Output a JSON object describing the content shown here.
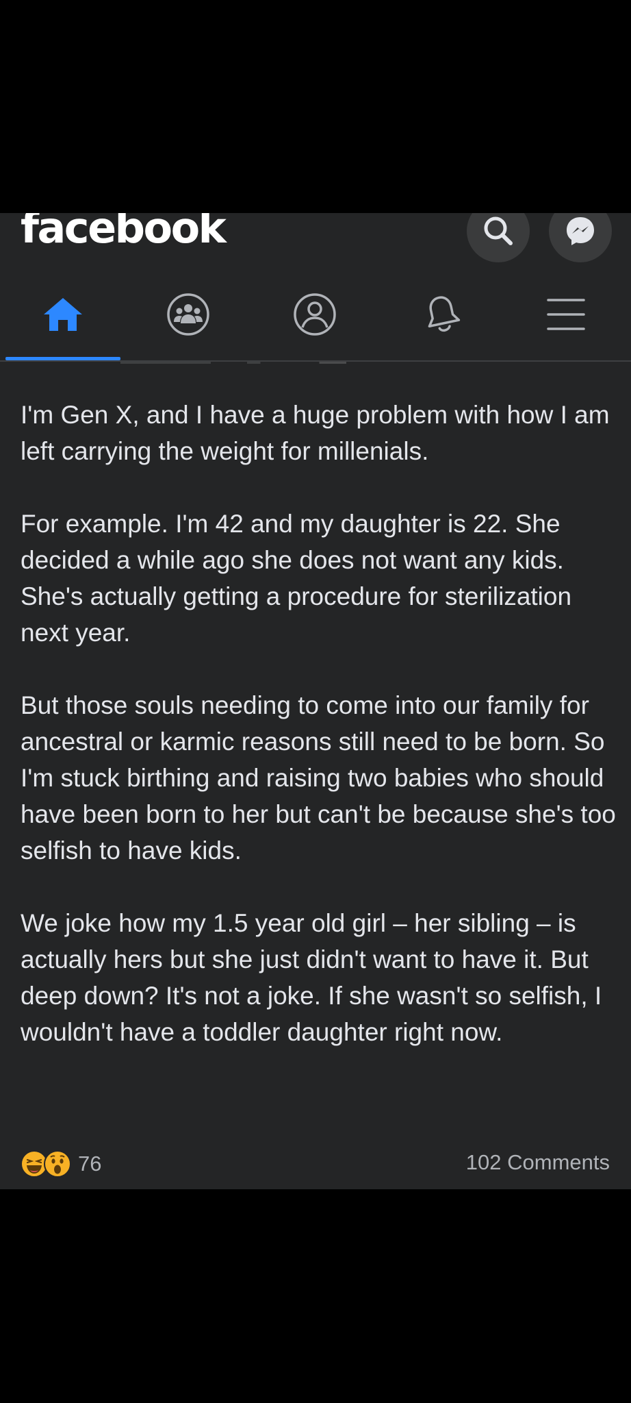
{
  "app": {
    "logo": "facebook"
  },
  "header_icons": [
    "search-icon",
    "messenger-icon"
  ],
  "nav": {
    "items": [
      {
        "name": "home",
        "icon": "home-icon",
        "active": true
      },
      {
        "name": "groups",
        "icon": "groups-icon",
        "active": false
      },
      {
        "name": "profile",
        "icon": "profile-icon",
        "active": false
      },
      {
        "name": "notifications",
        "icon": "bell-icon",
        "active": false
      },
      {
        "name": "menu",
        "icon": "menu-icon",
        "active": false
      }
    ]
  },
  "post": {
    "paragraphs": [
      "I'm Gen X, and I have a huge problem with how I am left carrying the weight for millenials.",
      "For example. I'm 42 and my daughter is 22. She decided a while ago she does not want any kids. She's actually getting a procedure for sterilization next year.",
      "But those souls needing to come into our family for ancestral or karmic reasons still need to be born. So I'm stuck birthing and raising two babies who should have been born to her but can't be because she's too selfish to have kids.",
      "We joke how my 1.5 year old girl – her sibling – is actually hers but she just didn't want to have it. But deep down? It's not a joke. If she wasn't so selfish, I wouldn't have a toddler daughter right now."
    ],
    "reactions": {
      "icons": [
        "haha-emoji",
        "wow-emoji"
      ],
      "count": "76"
    },
    "comments": "102 Comments"
  },
  "colors": {
    "background": "#242526",
    "text": "#e4e6eb",
    "secondary_text": "#b0b3b8",
    "accent": "#2d88ff",
    "reaction_yellow": "#f7b125"
  }
}
